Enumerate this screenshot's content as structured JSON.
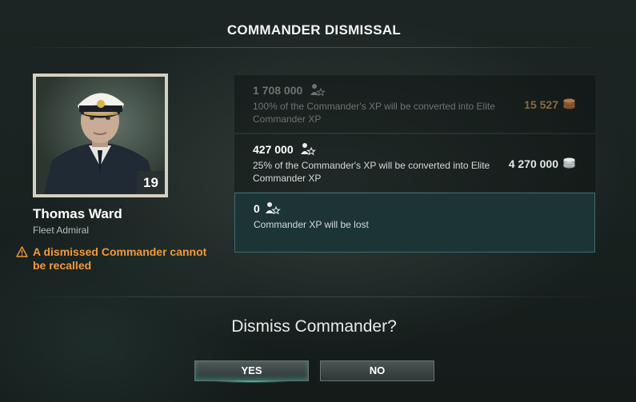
{
  "dialog": {
    "title": "COMMANDER DISMISSAL",
    "question": "Dismiss Commander?"
  },
  "commander": {
    "name": "Thomas Ward",
    "rank": "Fleet Admiral",
    "level": "19",
    "warning": "A dismissed Commander cannot be recalled"
  },
  "options": [
    {
      "xp": "1 708 000",
      "description": "100% of the Commander's XP will be converted into Elite Commander XP",
      "cost": "15 527",
      "cost_icon": "doubloons-icon",
      "state": "disabled"
    },
    {
      "xp": "427 000",
      "description": "25% of the Commander's XP will be converted into Elite Commander XP",
      "cost": "4 270 000",
      "cost_icon": "credits-icon",
      "state": "available"
    },
    {
      "xp": "0",
      "description": "Commander XP will be lost",
      "cost": "",
      "state": "selected"
    }
  ],
  "buttons": {
    "yes": "YES",
    "no": "NO"
  },
  "colors": {
    "warning": "#f09a3a",
    "selected_bg": "#1d3436",
    "doubloons": "#8a6a3e",
    "accent_glow": "#5affd2"
  }
}
